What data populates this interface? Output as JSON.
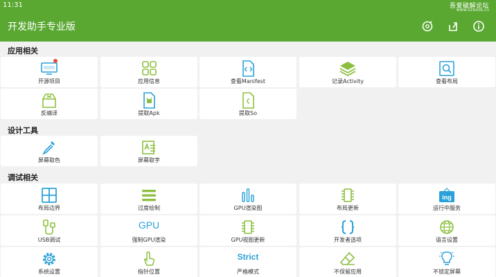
{
  "status": {
    "time": "11:31",
    "watermark_top": "吾爱破解论坛",
    "watermark_bottom": "www.52pojie.cn"
  },
  "appbar": {
    "title": "开发助手专业版"
  },
  "sections": {
    "app": "应用相关",
    "design": "设计工具",
    "debug": "调试相关"
  },
  "app_items": [
    "开源项目",
    "应用信息",
    "查看Manifest",
    "记录Activity",
    "查看布局",
    "反编译",
    "提取Apk",
    "提取So"
  ],
  "design_items": [
    "屏幕取色",
    "屏幕取字"
  ],
  "debug_items": [
    "布局边界",
    "过度绘制",
    "GPU渲染图",
    "布局更新",
    "运行中服务",
    "USB调试",
    "强制GPU渲染",
    "GPU视图更新",
    "开发者选项",
    "语言设置",
    "系统设置",
    "指针位置",
    "严格模式",
    "不保留应用",
    "不锁定屏幕"
  ],
  "icon_texts": {
    "gpu": "GPU",
    "strict": "Strict",
    "ing": "ing",
    "code": "CODE"
  },
  "colors": {
    "primary": "#5aa832",
    "accent_blue": "#2aa1d8",
    "accent_green": "#8cbf3f",
    "badge_red": "#e84c3d"
  }
}
